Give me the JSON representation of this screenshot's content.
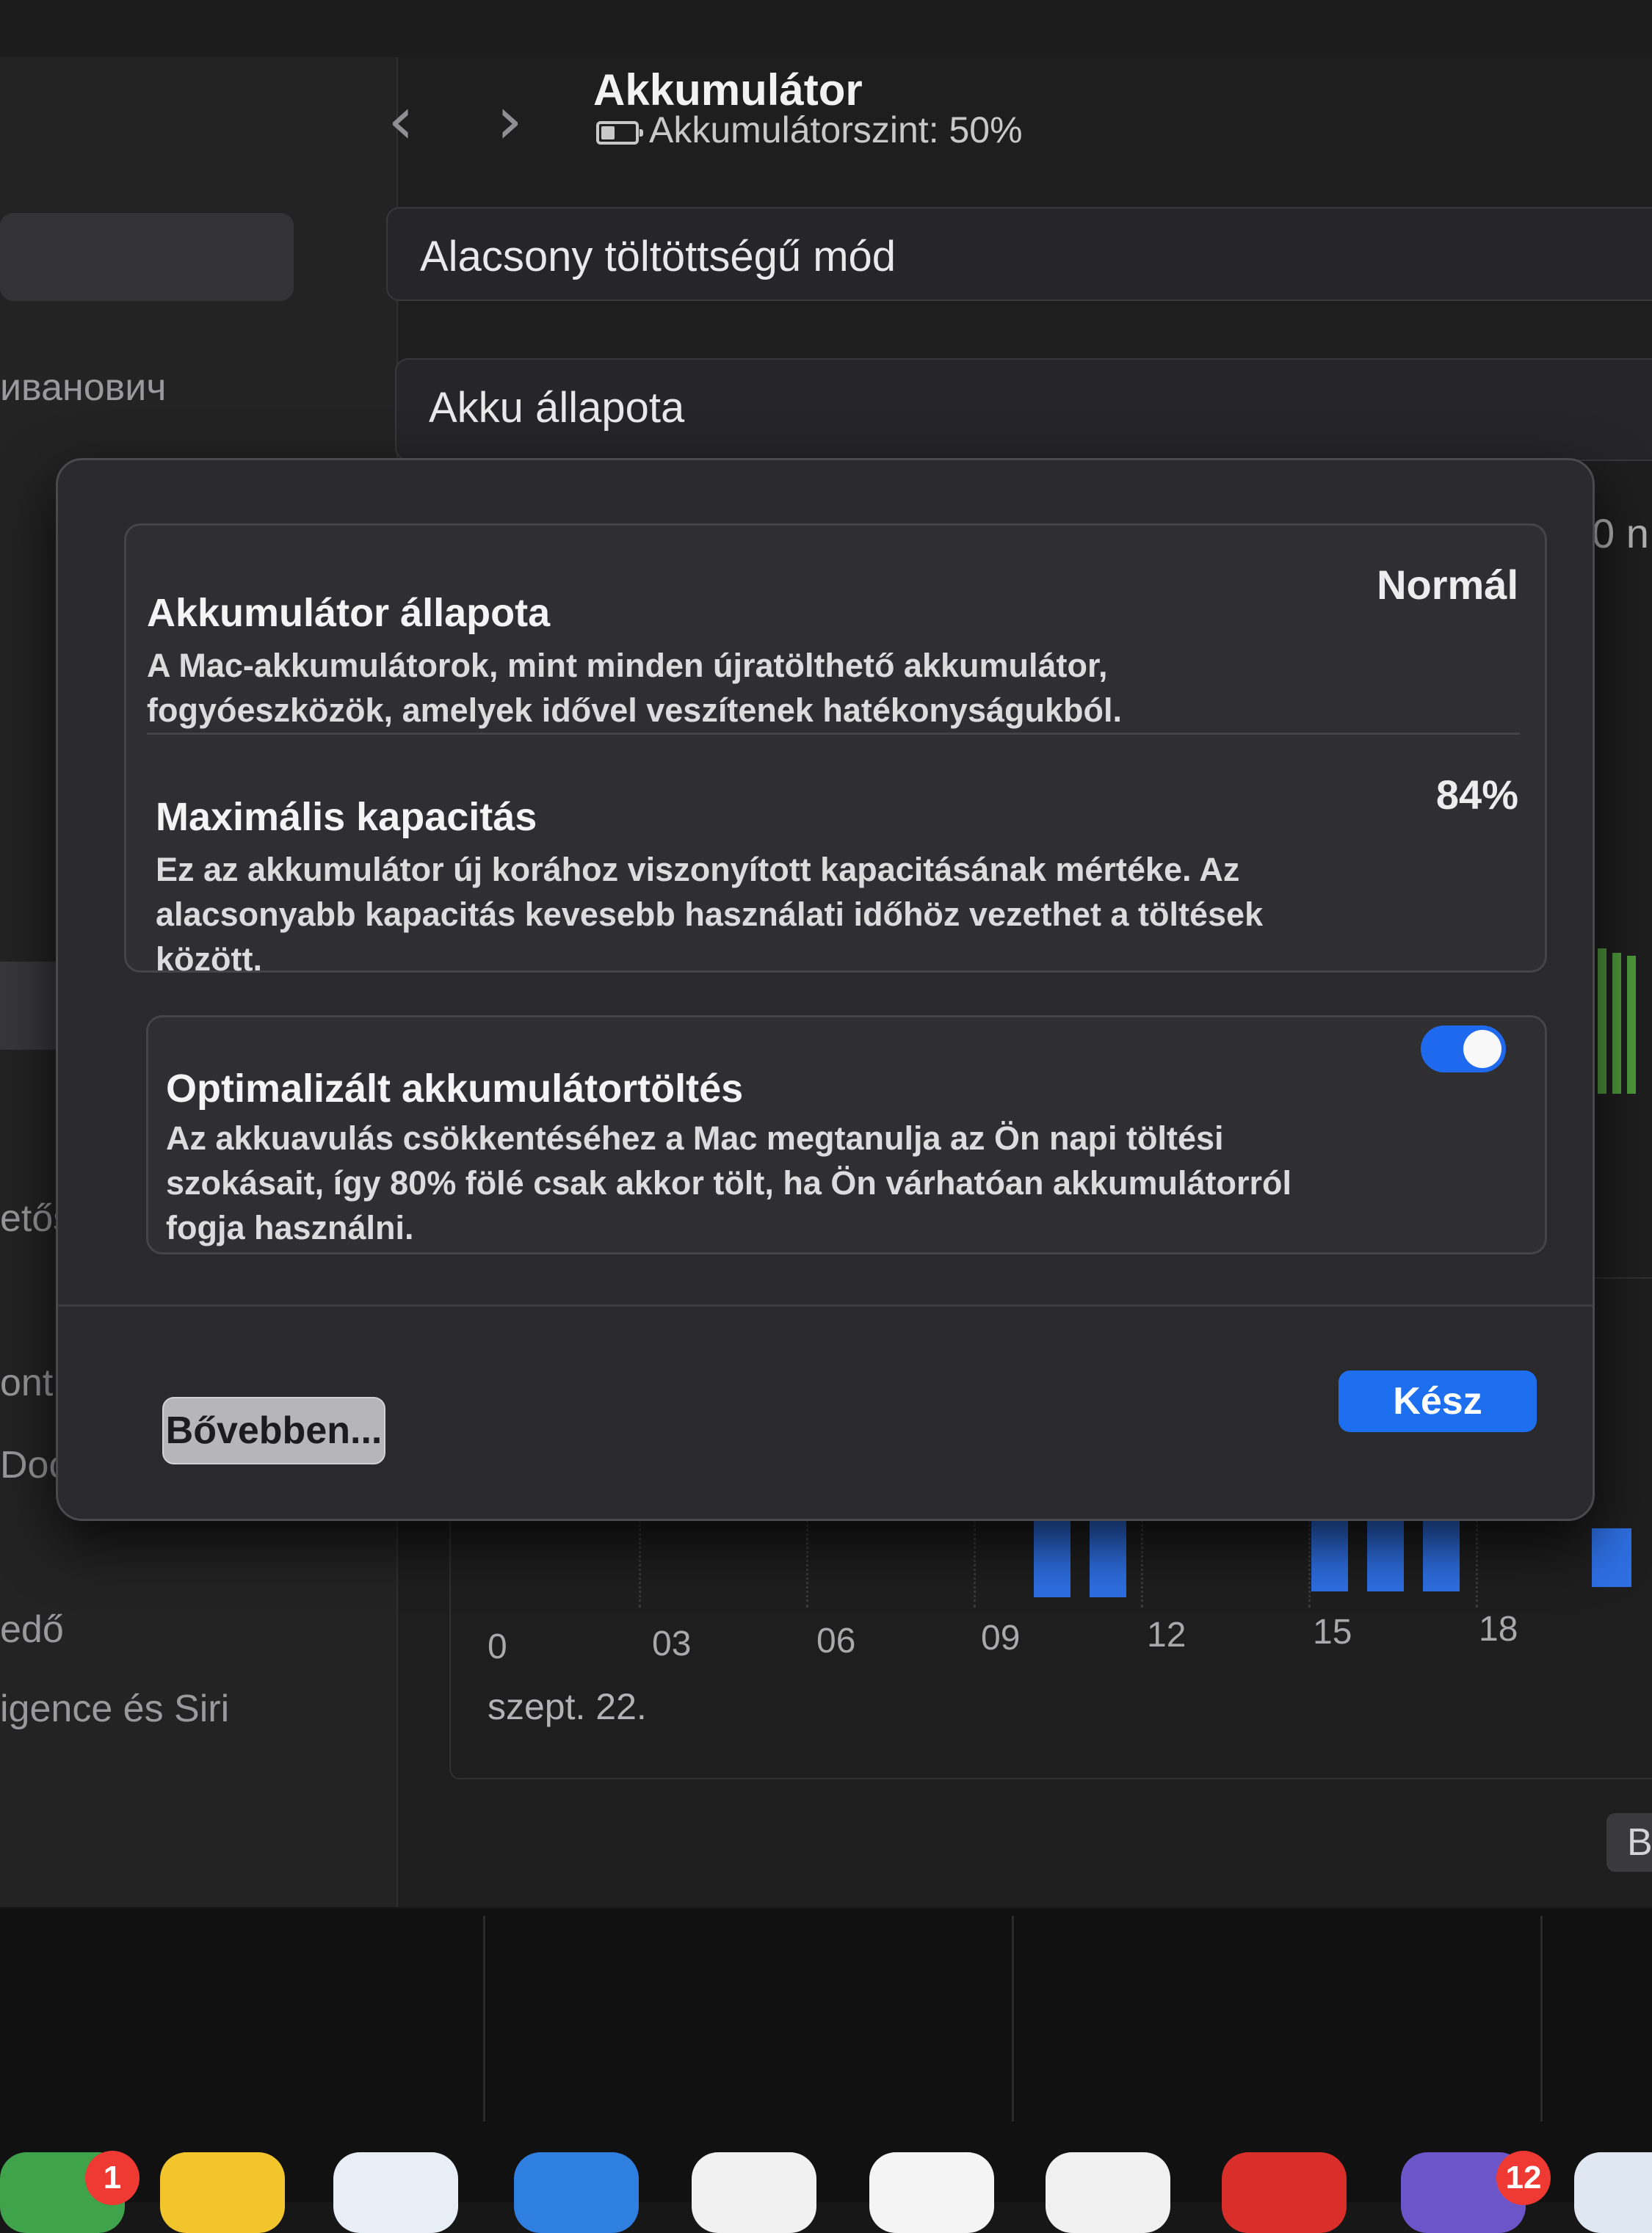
{
  "window": {
    "title": "Akkumulátor",
    "battery_level": "Akkumulátorszint: 50%",
    "back_icon": "chevron-left-icon",
    "forward_icon": "chevron-right-icon"
  },
  "sidebar": {
    "user_name_fragment": "иванович",
    "items": [
      {
        "label": "etősé"
      },
      {
        "label": "ont"
      },
      {
        "label": "Dock"
      },
      {
        "label": "edő"
      },
      {
        "label": "igence és Siri"
      }
    ]
  },
  "main": {
    "rows": [
      {
        "label": "Alacsony töltöttségű mód"
      },
      {
        "label": "Akku állapota"
      }
    ],
    "overflow_text": "0 n",
    "b_button": "B"
  },
  "chart_data": {
    "type": "bar",
    "x_ticks": [
      "0",
      "03",
      "06",
      "09",
      "12",
      "15",
      "18"
    ],
    "date_label": "szept. 22.",
    "bars_visible_partially": true,
    "bar_color": "#2e6fe3",
    "charge_color": "#4f9a3c"
  },
  "dialog": {
    "health_title": "Akkumulátor állapota",
    "health_value": "Normál",
    "health_desc": "A Mac-akkumulátorok, mint minden újratölthető akkumulátor, fogyóeszközök, amelyek idővel veszítenek hatékonyságukból.",
    "capacity_title": "Maximális kapacitás",
    "capacity_value": "84%",
    "capacity_desc": "Ez az akkumulátor új korához viszonyított kapacitásának mértéke. Az alacsonyabb kapacitás kevesebb használati időhöz vezethet a töltések között.",
    "optimized_title": "Optimalizált akkumulátortöltés",
    "optimized_desc": "Az akkuavulás csökkentéséhez a Mac megtanulja az Ön napi töltési szokásait, így 80% fölé csak akkor tölt, ha Ön várhatóan akkumulátorról fogja használni.",
    "optimized_enabled": true,
    "more_button": "Bővebben...",
    "done_button": "Kész"
  },
  "dock": {
    "badges": [
      "1",
      "12"
    ]
  },
  "colors": {
    "accent": "#1e6ff0",
    "badge": "#ee3a32"
  }
}
